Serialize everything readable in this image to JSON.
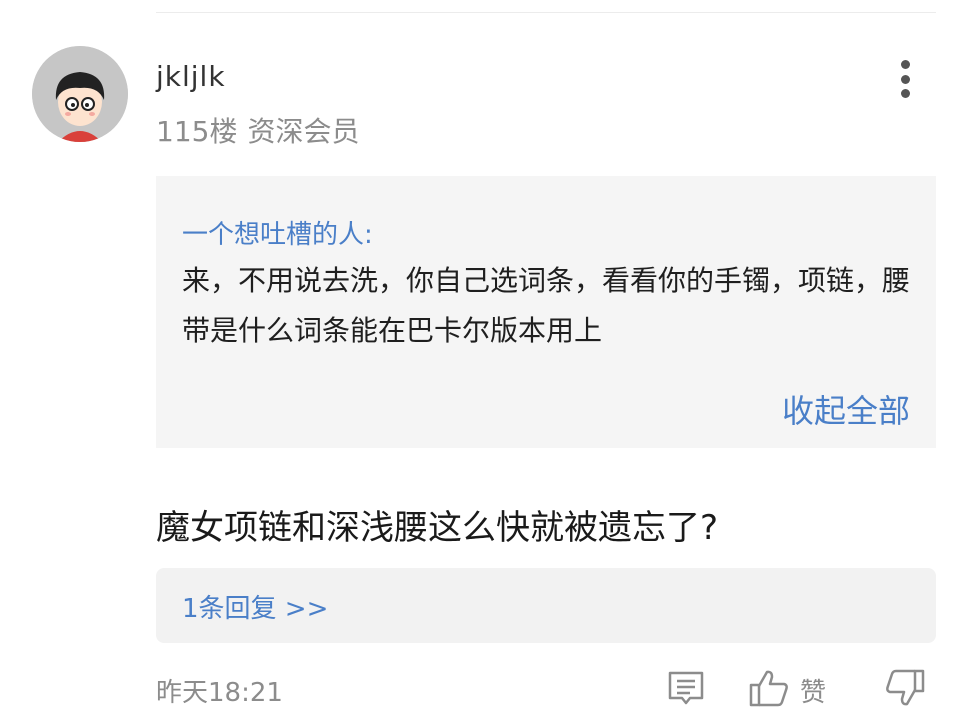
{
  "post": {
    "author": "jkljlk",
    "floor": "115楼",
    "rank": "资深会员",
    "avatar_icon": "cartoon-avatar-icon",
    "more_icon": "more-vertical-icon"
  },
  "quote": {
    "author": "一个想吐槽的人:",
    "text": "来，不用说去洗，你自己选词条，看看你的手镯，项链，腰带是什么词条能在巴卡尔版本用上",
    "collapse_label": "收起全部"
  },
  "content": "魔女项链和深浅腰这么快就被遗忘了?",
  "replies_label": "1条回复 >>",
  "footer": {
    "time": "昨天18:21",
    "comment_icon": "comment-icon",
    "like_icon": "thumbs-up-icon",
    "like_label": "赞",
    "dislike_icon": "thumbs-down-icon"
  },
  "colors": {
    "link": "#4a7fc8",
    "quote_bg": "#f5f5f5",
    "replies_bg": "#f2f2f2",
    "muted": "#8c8c8c"
  }
}
